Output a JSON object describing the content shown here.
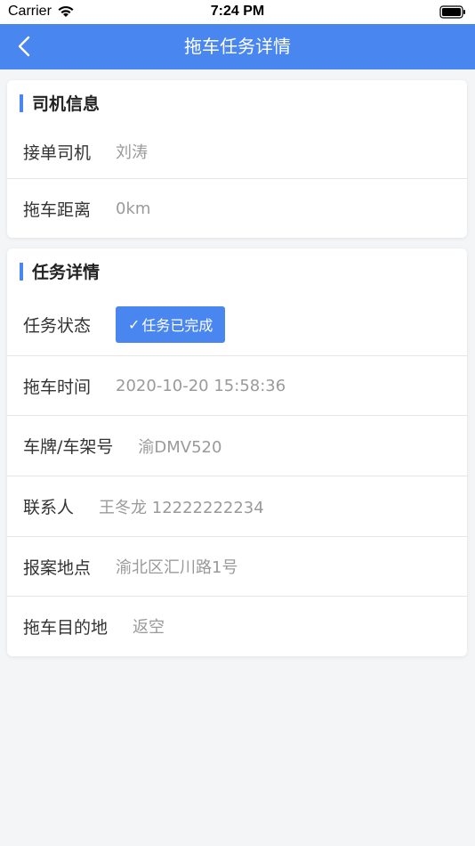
{
  "status_bar": {
    "carrier": "Carrier",
    "time": "7:24 PM"
  },
  "nav": {
    "title": "拖车任务详情"
  },
  "driver_card": {
    "title": "司机信息",
    "rows": [
      {
        "label": "接单司机",
        "value": "刘涛"
      },
      {
        "label": "拖车距离",
        "value": "0km"
      }
    ]
  },
  "task_card": {
    "title": "任务详情",
    "status_label": "任务状态",
    "status_value": "任务已完成",
    "rows": [
      {
        "label": "拖车时间",
        "value": "2020-10-20 15:58:36"
      },
      {
        "label": "车牌/车架号",
        "value": "渝DMV520"
      },
      {
        "label": "联系人",
        "value": "王冬龙 12222222234"
      },
      {
        "label": "报案地点",
        "value": "渝北区汇川路1号"
      },
      {
        "label": "拖车目的地",
        "value": "返空"
      }
    ]
  },
  "colors": {
    "accent": "#4a86f0",
    "background": "#f4f5f7"
  },
  "icons": [
    "wifi-icon",
    "battery-icon",
    "back-chevron-icon",
    "check-icon"
  ]
}
